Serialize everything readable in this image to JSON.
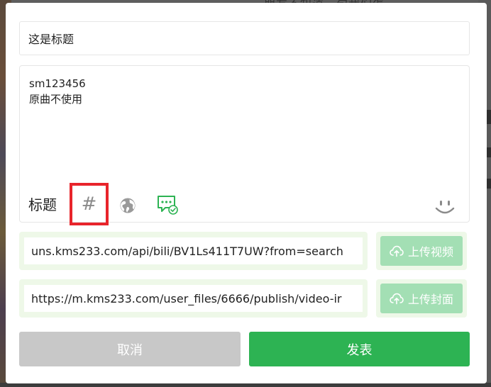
{
  "background": {
    "top_text": "朋友不知道一句我们怎"
  },
  "dialog": {
    "title_value": "这是标题",
    "content": {
      "lines": [
        "sm123456",
        "原曲不使用"
      ]
    },
    "toolbar": {
      "label": "标题",
      "hash_symbol": "#",
      "icons": [
        "hash-icon",
        "globe-icon",
        "chat-check-icon",
        "smile-icon"
      ]
    },
    "video_url": "uns.kms233.com/api/bili/BV1Ls411T7UW?from=search",
    "cover_url": "https://m.kms233.com/user_files/6666/publish/video-ir",
    "upload_video_label": "上传视频",
    "upload_cover_label": "上传封面",
    "cancel_label": "取消",
    "submit_label": "发表"
  },
  "colors": {
    "accent": "#2db353",
    "upload_button": "#a3dfb4",
    "cancel_button": "#c8c8c8",
    "highlight_box": "#e8242b",
    "input_row_bg": "#eef8e8"
  }
}
